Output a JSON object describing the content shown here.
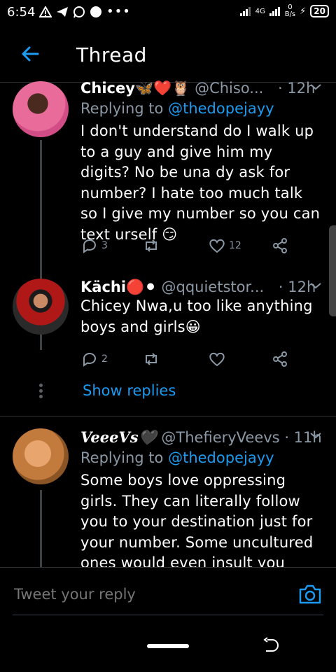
{
  "status": {
    "time": "6:54",
    "net_up": "0",
    "net_unit": "B/s",
    "network": "4G",
    "battery": "20"
  },
  "header": {
    "title": "Thread"
  },
  "tweets": [
    {
      "name": "Chicey🦋❤️🦉",
      "handle": "@Chiso...",
      "time": "· 12h",
      "replying_label": "Replying to",
      "replying_to": "@thedopejayy",
      "text": "I don't understand do I walk up to a guy and give him my digits? No be una dy ask for number? I hate too much talk so I give my number so you can text urself 😏",
      "replies": "3",
      "retweets": "",
      "likes": "12"
    },
    {
      "name": "Kächi🔴⚫",
      "handle": "@qquietstor...",
      "time": "· 12h",
      "text": "Chicey Nwa,u too like anything boys and girls😀",
      "replies": "2",
      "retweets": "",
      "likes": ""
    },
    {
      "name": "VeeeVs🖤",
      "handle": "@ThefieryVeevs",
      "time": "· 11h",
      "replying_label": "Replying to",
      "replying_to": "@thedopejayy",
      "text": "Some boys love oppressing girls. They can literally follow you to your destination just for your number. Some uncultured ones would even insult you openly if you don't give"
    }
  ],
  "show_replies": "Show replies",
  "reply_box": {
    "placeholder": "Tweet your reply"
  },
  "colors": {
    "accent": "#1d9bf0",
    "muted": "#8b98a5",
    "background": "#000000"
  }
}
